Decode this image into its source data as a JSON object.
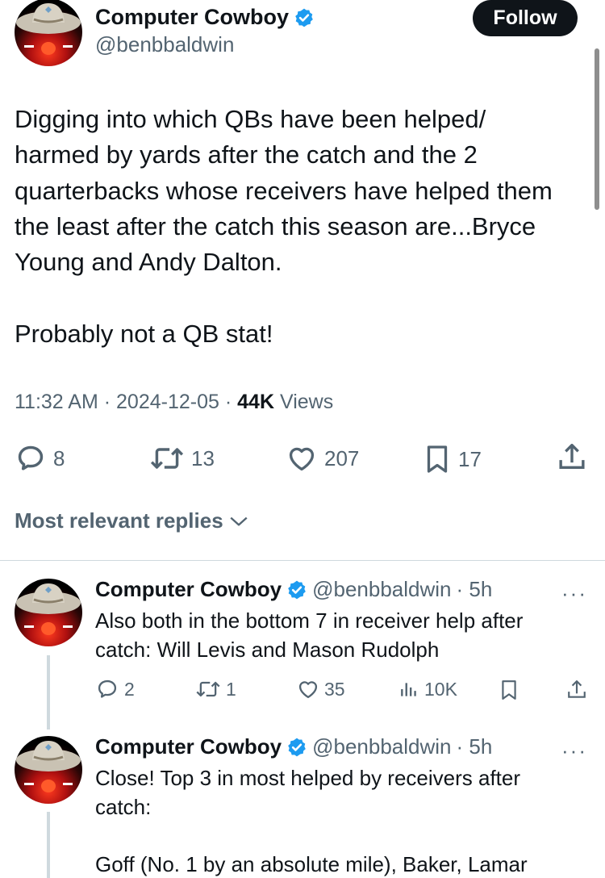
{
  "tweet": {
    "author_name": "Computer Cowboy",
    "author_handle": "@benbbaldwin",
    "follow_label": "Follow",
    "lines": [
      "Digging into which QBs have been helped/",
      "harmed by yards after the catch and the 2",
      "quarterbacks whose receivers have helped them",
      "the least after the catch this season are...Bryce",
      "Young and Andy Dalton.",
      "",
      "Probably not a QB stat!"
    ],
    "time": "11:32 AM",
    "date": "2024-12-05",
    "views_count": "44K",
    "views_label": "Views",
    "separator": "·",
    "replies": "8",
    "reposts": "13",
    "likes": "207",
    "bookmarks": "17"
  },
  "replies_sort": {
    "label": "Most relevant replies"
  },
  "replies": [
    {
      "author_name": "Computer Cowboy",
      "author_handle": "@benbbaldwin",
      "time_ago": "· 5h",
      "more": "···",
      "lines": [
        "Also both in the bottom 7 in receiver help after",
        "catch: Will Levis and Mason Rudolph"
      ],
      "replies": "2",
      "reposts": "1",
      "likes": "35",
      "views": "10K"
    },
    {
      "author_name": "Computer Cowboy",
      "author_handle": "@benbbaldwin",
      "time_ago": "· 5h",
      "more": "···",
      "lines": [
        "Close! Top 3 in most helped by receivers after",
        "catch:",
        "",
        "Goff (No. 1 by an absolute mile), Baker, Lamar"
      ]
    }
  ],
  "colors": {
    "text": "#0f1419",
    "secondary": "#536471",
    "verified": "#1d9bf0",
    "divider": "#cfd9de",
    "follow_bg": "#0f1419"
  },
  "icons": {
    "reply": "speech-bubble-icon",
    "repost": "repost-arrows-icon",
    "like": "heart-icon",
    "bookmark": "bookmark-icon",
    "share": "share-upload-icon",
    "views": "bar-chart-icon",
    "verified": "verified-badge-icon",
    "sort": "chevron-down-icon"
  }
}
